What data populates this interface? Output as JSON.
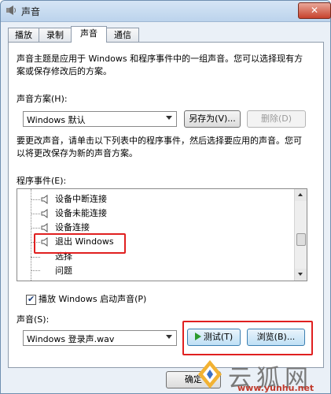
{
  "window": {
    "title": "声音",
    "close_label": "✕"
  },
  "tabs": [
    {
      "label": "播放"
    },
    {
      "label": "录制"
    },
    {
      "label": "声音"
    },
    {
      "label": "通信"
    }
  ],
  "description": {
    "line1": "声音主题是应用于 Windows 和程序事件中的一组声音。您可以选择现有方",
    "line2": "案或保存修改后的方案。"
  },
  "scheme": {
    "label": "声音方案(H):",
    "value": "Windows 默认",
    "save_as_label": "另存为(V)...",
    "delete_label": "删除(D)"
  },
  "instruction": {
    "line1": "要更改声音，请单击以下列表中的程序事件，然后选择要应用的声音。您可",
    "line2": "以将更改保存为新的声音方案。"
  },
  "events": {
    "label": "程序事件(E):",
    "items": [
      {
        "label": "设备中断连接"
      },
      {
        "label": "设备未能连接"
      },
      {
        "label": "设备连接"
      },
      {
        "label": "退出 Windows"
      },
      {
        "label": "选择"
      },
      {
        "label": "问题"
      }
    ]
  },
  "startup": {
    "label": "播放 Windows 启动声音(P)",
    "checked": true
  },
  "sound": {
    "label": "声音(S):",
    "value": "Windows 登录声.wav",
    "test_label": "测试(T)",
    "browse_label": "浏览(B)..."
  },
  "footer": {
    "ok_label": "确定"
  },
  "watermark": {
    "text": "云狐网",
    "url": "www.yunhu.net"
  },
  "colors": {
    "highlight_box": "#e02020",
    "play_icon": "#2c9a2c"
  }
}
